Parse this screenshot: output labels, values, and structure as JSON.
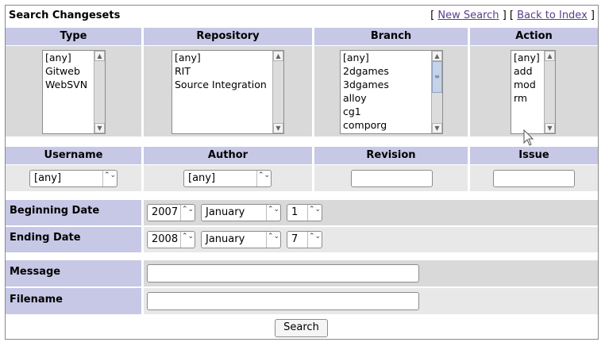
{
  "title": "Search Changesets",
  "links": {
    "new_search": "New Search",
    "back": "Back to Index",
    "open": "[",
    "sep": "] [",
    "close": "]"
  },
  "columns": {
    "type": "Type",
    "repository": "Repository",
    "branch": "Branch",
    "action": "Action"
  },
  "lists": {
    "type": [
      "[any]",
      "Gitweb",
      "WebSVN"
    ],
    "repository": [
      "[any]",
      "RIT",
      "Source Integration"
    ],
    "branch": [
      "[any]",
      "2dgames",
      "3dgames",
      "alloy",
      "cg1",
      "comporg"
    ],
    "action": [
      "[any]",
      "add",
      "mod",
      "rm"
    ]
  },
  "columns2": {
    "username": "Username",
    "author": "Author",
    "revision": "Revision",
    "issue": "Issue"
  },
  "username_value": "[any]",
  "author_value": "[any]",
  "revision_value": "",
  "issue_value": "",
  "dates": {
    "begin_label": "Beginning Date",
    "end_label": "Ending Date",
    "begin": {
      "year": "2007",
      "month": "January",
      "day": "1"
    },
    "end": {
      "year": "2008",
      "month": "January",
      "day": "7"
    }
  },
  "message_label": "Message",
  "filename_label": "Filename",
  "message_value": "",
  "filename_value": "",
  "search_button": "Search",
  "icons": {
    "up": "▲",
    "down": "▼",
    "updown": "⌃⌄",
    "grip": "≡"
  }
}
